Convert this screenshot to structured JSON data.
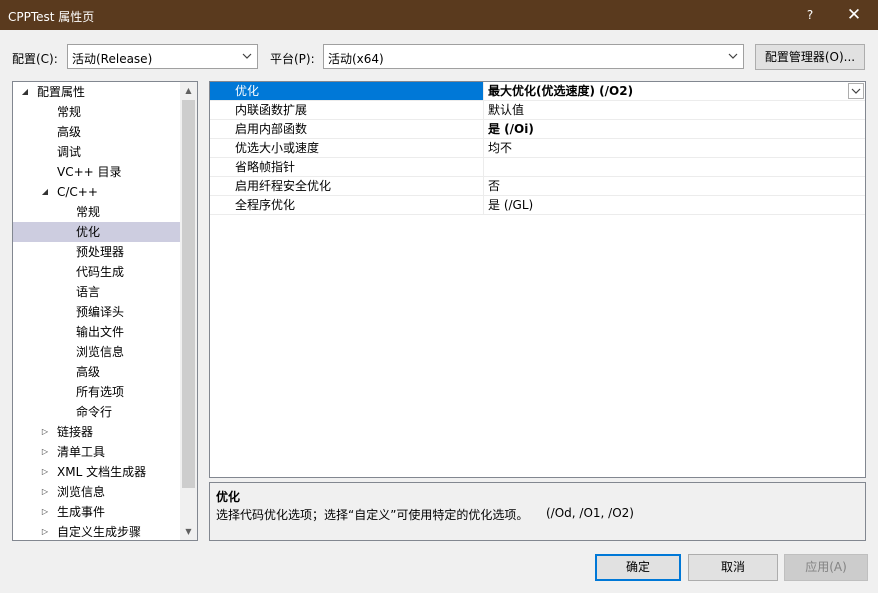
{
  "window": {
    "title": "CPPTest 属性页",
    "help_label": "?",
    "close_label": "✕"
  },
  "config": {
    "config_label": "配置(C):",
    "config_value": "活动(Release)",
    "platform_label": "平台(P):",
    "platform_value": "活动(x64)",
    "manager_label": "配置管理器(O)..."
  },
  "tree": {
    "items": [
      {
        "label": "配置属性",
        "level": 0,
        "expander": "open"
      },
      {
        "label": "常规",
        "level": 1
      },
      {
        "label": "高级",
        "level": 1
      },
      {
        "label": "调试",
        "level": 1
      },
      {
        "label": "VC++ 目录",
        "level": 1
      },
      {
        "label": "C/C++",
        "level": 1,
        "expander": "open"
      },
      {
        "label": "常规",
        "level": 2
      },
      {
        "label": "优化",
        "level": 2,
        "selected": true
      },
      {
        "label": "预处理器",
        "level": 2
      },
      {
        "label": "代码生成",
        "level": 2
      },
      {
        "label": "语言",
        "level": 2
      },
      {
        "label": "预编译头",
        "level": 2
      },
      {
        "label": "输出文件",
        "level": 2
      },
      {
        "label": "浏览信息",
        "level": 2
      },
      {
        "label": "高级",
        "level": 2
      },
      {
        "label": "所有选项",
        "level": 2
      },
      {
        "label": "命令行",
        "level": 2
      },
      {
        "label": "链接器",
        "level": 1,
        "expander": "closed"
      },
      {
        "label": "清单工具",
        "level": 1,
        "expander": "closed"
      },
      {
        "label": "XML 文档生成器",
        "level": 1,
        "expander": "closed"
      },
      {
        "label": "浏览信息",
        "level": 1,
        "expander": "closed"
      },
      {
        "label": "生成事件",
        "level": 1,
        "expander": "closed"
      },
      {
        "label": "自定义生成步骤",
        "level": 1,
        "expander": "closed"
      }
    ]
  },
  "properties": {
    "rows": [
      {
        "name": "优化",
        "value": "最大优化(优选速度) (/O2)",
        "bold": true,
        "selected": true
      },
      {
        "name": "内联函数扩展",
        "value": "默认值",
        "bold": false
      },
      {
        "name": "启用内部函数",
        "value": "是 (/Oi)",
        "bold": true
      },
      {
        "name": "优选大小或速度",
        "value": "均不",
        "bold": false
      },
      {
        "name": "省略帧指针",
        "value": "",
        "bold": false
      },
      {
        "name": "启用纤程安全优化",
        "value": "否",
        "bold": false
      },
      {
        "name": "全程序优化",
        "value": "是 (/GL)",
        "bold": false
      }
    ]
  },
  "description": {
    "title": "优化",
    "text": "选择代码优化选项；选择“自定义”可使用特定的优化选项。",
    "options": "(/Od, /O1, /O2)"
  },
  "buttons": {
    "ok": "确定",
    "cancel": "取消",
    "apply": "应用(A)"
  },
  "colors": {
    "titlebar": "#5a3a1e",
    "selection": "#0078d7",
    "tree_selection": "#cdcde0"
  }
}
